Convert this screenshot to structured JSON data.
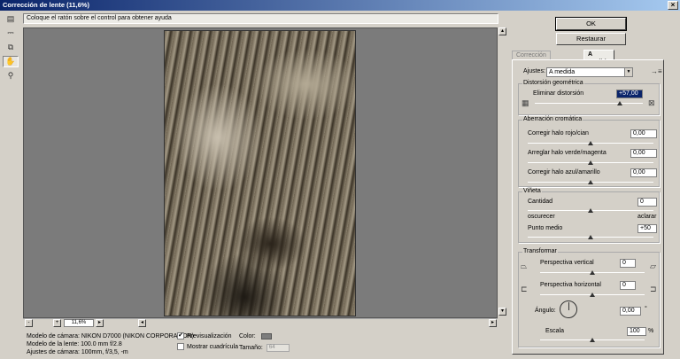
{
  "window": {
    "title": "Corrección de lente (11,6%)",
    "close_glyph": "×"
  },
  "hint": "Coloque el ratón sobre el control para obtener ayuda",
  "tools": [
    {
      "name": "remove-distortion-tool-icon",
      "glyph": "▤"
    },
    {
      "name": "straighten-tool-icon",
      "glyph": "⎓"
    },
    {
      "name": "move-grid-tool-icon",
      "glyph": "⧉"
    },
    {
      "name": "hand-tool-icon",
      "glyph": "✋"
    },
    {
      "name": "zoom-tool-icon",
      "glyph": "⚲"
    }
  ],
  "zoom": {
    "value": "11,6%",
    "minus": "-",
    "plus": "+"
  },
  "info": {
    "camera": "Modelo de cámara: NIKON D7000 (NIKON CORPORATION)",
    "lens": "Modelo de la lente: 100.0 mm f/2.8",
    "settings": "Ajustes de cámara: 100mm, f/3,5, -m"
  },
  "options": {
    "preview_label": "Previsualización",
    "preview_checked": "✔",
    "grid_label": "Mostrar cuadrícula",
    "color_label": "Color:",
    "size_label": "Tamaño:",
    "size_value": "64"
  },
  "buttons": {
    "ok": "OK",
    "reset": "Restaurar"
  },
  "tabs": {
    "auto": "Corrección automática",
    "custom": "A medida"
  },
  "settings_row": {
    "label": "Ajustes:",
    "value": "A medida",
    "arrow": "▼",
    "menu_glyph": "→≡"
  },
  "geometric": {
    "title": "Distorsión geométrica",
    "remove_label": "Eliminar distorsión",
    "remove_value": "+57,00",
    "remove_fraction": 0.79
  },
  "chromatic": {
    "title": "Aberración cromática",
    "rows": [
      {
        "label": "Corregir halo rojo/cian",
        "value": "0,00",
        "fraction": 0.5
      },
      {
        "label": "Arreglar halo verde/magenta",
        "value": "0,00",
        "fraction": 0.5
      },
      {
        "label": "Corregir halo azul/amarillo",
        "value": "0,00",
        "fraction": 0.5
      }
    ]
  },
  "vignette": {
    "title": "Viñeta",
    "amount_label": "Cantidad",
    "amount_value": "0",
    "amount_fraction": 0.5,
    "darken_label": "oscurecer",
    "lighten_label": "aclarar",
    "midpoint_label": "Punto medio",
    "midpoint_value": "+50",
    "midpoint_fraction": 0.5
  },
  "transform": {
    "title": "Transformar",
    "vertical_label": "Perspectiva vertical",
    "vertical_value": "0",
    "vertical_fraction": 0.5,
    "horizontal_label": "Perspectiva horizontal",
    "horizontal_value": "0",
    "horizontal_fraction": 0.5,
    "angle_label": "Ángulo:",
    "angle_value": "0,00",
    "angle_unit": "°",
    "scale_label": "Escala",
    "scale_value": "100",
    "scale_unit": "%",
    "scale_fraction": 0.5
  },
  "colors": {
    "title_start": "#0a246a",
    "title_end": "#a6caf0",
    "selection": "#0a246a",
    "preview_bg": "#7b7b7b"
  }
}
